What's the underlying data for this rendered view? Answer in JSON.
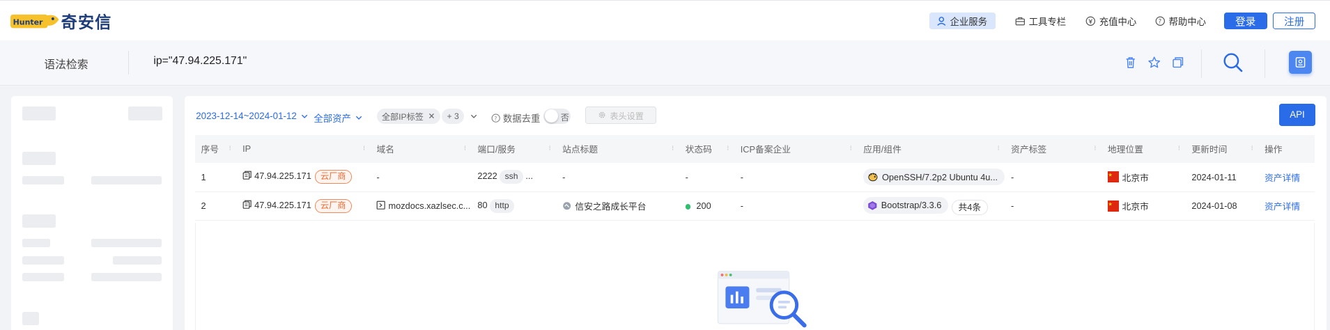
{
  "header": {
    "logo_text": "奇安信",
    "logo_mark_text": "Hunter",
    "nav": [
      {
        "label": "企业服务",
        "icon": "enterprise-icon"
      },
      {
        "label": "工具专栏",
        "icon": "toolbox-icon"
      },
      {
        "label": "充值中心",
        "icon": "coin-icon"
      },
      {
        "label": "帮助中心",
        "icon": "help-icon"
      }
    ],
    "login_label": "登录",
    "register_label": "注册"
  },
  "search": {
    "mode_label": "语法检索",
    "query": "ip=\"47.94.225.171\""
  },
  "filters": {
    "date_range": "2023-12-14~2024-01-12",
    "asset_scope": "全部资产",
    "ip_tag": "全部IP标签",
    "more_tags": "+ 3",
    "dedupe_label": "数据去重",
    "dedupe_state": "否",
    "column_settings": "表头设置",
    "api_label": "API"
  },
  "table": {
    "columns": [
      "序号",
      "IP",
      "域名",
      "端口/服务",
      "站点标题",
      "状态码",
      "ICP备案企业",
      "应用/组件",
      "资产标签",
      "地理位置",
      "更新时间",
      "操作"
    ],
    "rows": [
      {
        "no": "1",
        "ip": "47.94.225.171",
        "ip_badge": "云厂商",
        "domain": "-",
        "port": "2222",
        "service": "ssh",
        "service_more": "...",
        "title": "-",
        "status": "-",
        "icp": "-",
        "app": "OpenSSH/7.2p2 Ubuntu 4u...",
        "app_count": "",
        "tags": "-",
        "geo": "北京市",
        "updated": "2024-01-11",
        "action": "资产详情"
      },
      {
        "no": "2",
        "ip": "47.94.225.171",
        "ip_badge": "云厂商",
        "domain": "mozdocs.xazlsec.c...",
        "port": "80",
        "service": "http",
        "service_more": "",
        "title": "信安之路成长平台",
        "status": "200",
        "icp": "-",
        "app": "Bootstrap/3.3.6",
        "app_count": "共4条",
        "tags": "-",
        "geo": "北京市",
        "updated": "2024-01-08",
        "action": "资产详情"
      }
    ]
  },
  "colors": {
    "accent": "#2a6ce8",
    "cloud_badge": "#f06a34",
    "status_ok": "#2fbf71",
    "flag_red": "#de2910"
  }
}
